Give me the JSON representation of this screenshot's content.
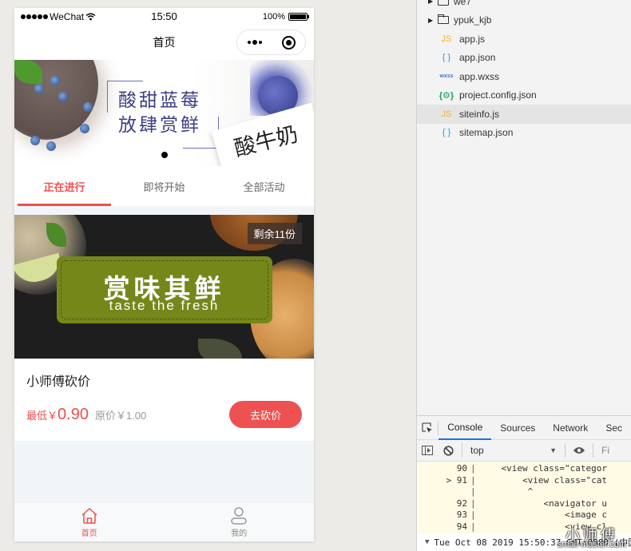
{
  "statusbar": {
    "carrier": "WeChat",
    "time": "15:50",
    "battery_text": "100%",
    "battery_level": 1.0
  },
  "navbar": {
    "title": "首页"
  },
  "banner": {
    "line1": "酸甜蓝莓",
    "line2": "放肆赏鲜",
    "product_text": "酸牛奶",
    "slide_count": 1,
    "active_slide": 1
  },
  "tabs": [
    {
      "label": "正在进行",
      "active": true
    },
    {
      "label": "即将开始",
      "active": false
    },
    {
      "label": "全部活动",
      "active": false
    }
  ],
  "card": {
    "image_title": "赏味其鲜",
    "image_subtitle": "taste the fresh",
    "remain_badge": "剩余11份",
    "title": "小师傅砍价",
    "price_label": "最低￥",
    "price_value": "0.90",
    "original_price": "原价￥1.00",
    "button_label": "去砍价"
  },
  "tabbar": {
    "items": [
      {
        "label": "首页",
        "icon": "home-icon",
        "active": true
      },
      {
        "label": "我的",
        "icon": "user-icon",
        "active": false
      }
    ]
  },
  "file_tree": {
    "items": [
      {
        "type": "folder",
        "name": "we7",
        "icon": "folder-icon"
      },
      {
        "type": "folder",
        "name": "ypuk_kjb",
        "icon": "folder-icon"
      },
      {
        "type": "file",
        "name": "app.js",
        "icon_text": "JS",
        "icon": "js-file-icon"
      },
      {
        "type": "file",
        "name": "app.json",
        "icon_text": "{ }",
        "icon": "json-file-icon"
      },
      {
        "type": "file",
        "name": "app.wxss",
        "icon_text": "wxss",
        "icon": "wxss-file-icon"
      },
      {
        "type": "file",
        "name": "project.config.json",
        "icon_text": "{⚙}",
        "icon": "config-file-icon"
      },
      {
        "type": "file",
        "name": "siteinfo.js",
        "icon_text": "JS",
        "icon": "js-file-icon",
        "selected": true
      },
      {
        "type": "file",
        "name": "sitemap.json",
        "icon_text": "{ }",
        "icon": "json-file-icon"
      }
    ]
  },
  "devtools": {
    "tabs": [
      {
        "label": "Console",
        "active": true
      },
      {
        "label": "Sources",
        "active": false
      },
      {
        "label": "Network",
        "active": false
      },
      {
        "label": "Sec",
        "active": false
      }
    ],
    "context": "top",
    "filter_placeholder": "Fi",
    "code_lines": [
      {
        "marker": "",
        "num": "90",
        "code": "    <view class=\"categor"
      },
      {
        "marker": ">",
        "num": "91",
        "code": "        <view class=\"cat"
      },
      {
        "marker": "",
        "num": "",
        "code": "         ^"
      },
      {
        "marker": "",
        "num": "92",
        "code": "            <navigator u"
      },
      {
        "marker": "",
        "num": "93",
        "code": "                <image c"
      },
      {
        "marker": "",
        "num": "94",
        "code": "                <view cl"
      }
    ],
    "log_date": "Tue Oct 08 2019 15:50:37 GMT+0800 (中国"
  },
  "watermark": {
    "title": "小师傅",
    "site": "small-master.com"
  },
  "colors": {
    "accent": "#ee4f4f",
    "green_panel": "#76871a",
    "devtools_active": "#1a73e8"
  }
}
